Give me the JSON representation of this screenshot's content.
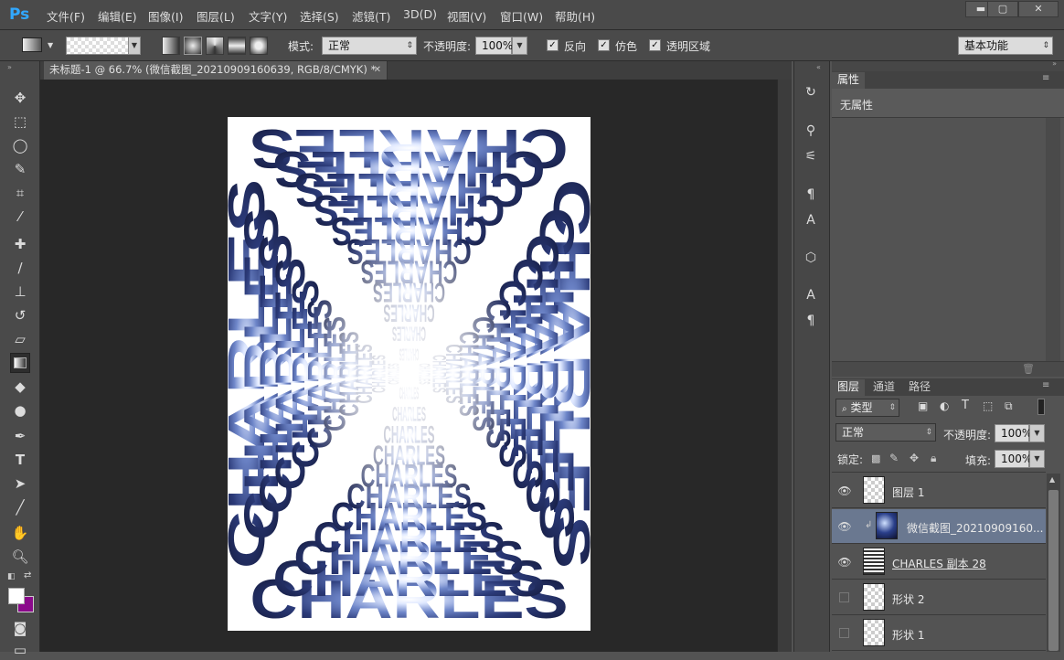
{
  "app": {
    "logo": "Ps"
  },
  "menu": [
    "文件(F)",
    "编辑(E)",
    "图像(I)",
    "图层(L)",
    "文字(Y)",
    "选择(S)",
    "滤镜(T)",
    "3D(D)",
    "视图(V)",
    "窗口(W)",
    "帮助(H)"
  ],
  "window_controls": {
    "minimize": "▬",
    "restore": "▢",
    "close": "✕"
  },
  "options": {
    "mode_label": "模式:",
    "mode_value": "正常",
    "opacity_label": "不透明度:",
    "opacity_value": "100%",
    "reverse_label": "反向",
    "dither_label": "仿色",
    "transparency_label": "透明区域",
    "workspace": "基本功能"
  },
  "document": {
    "tab_title": "未标题-1 @ 66.7% (微信截图_20210909160639, RGB/8/CMYK) *",
    "tab_close": "✕"
  },
  "artwork": {
    "text": "CHARLES"
  },
  "properties": {
    "tab": "属性",
    "content": "无属性"
  },
  "layers_panel": {
    "tabs": [
      "图层",
      "通道",
      "路径"
    ],
    "filter_label": "类型",
    "blend_mode": "正常",
    "opacity_label": "不透明度:",
    "opacity_value": "100%",
    "lock_label": "锁定:",
    "fill_label": "填充:",
    "fill_value": "100%",
    "layers": [
      {
        "name": "图层 1",
        "visible": true
      },
      {
        "name": "微信截图_20210909160...",
        "visible": true
      },
      {
        "name": "CHARLES 副本 28",
        "visible": true
      },
      {
        "name": "形状 2",
        "visible": false
      },
      {
        "name": "形状 1",
        "visible": false
      }
    ]
  },
  "colors": {
    "foreground": "#ffffff",
    "background": "#8b0a8b",
    "ps_blue": "#31a8ff"
  }
}
